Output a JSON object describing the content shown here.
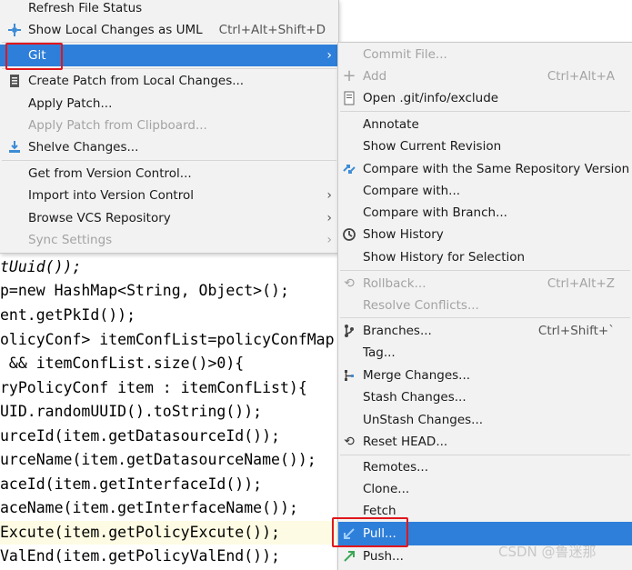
{
  "colors": {
    "menu_bg": "#f2f2f2",
    "selection": "#2e7fd9",
    "highlight_box": "#e0161c",
    "keyword": "#000080",
    "field": "#871094"
  },
  "menu_main": {
    "items": [
      {
        "label": "Refresh File Status",
        "icon": "",
        "disabled": false
      },
      {
        "label": "Show Local Changes as UML",
        "shortcut": "Ctrl+Alt+Shift+D",
        "icon": "uml-icon"
      },
      {
        "label": "Git",
        "submenu": true,
        "selected": true
      },
      {
        "label": "Create Patch from Local Changes...",
        "icon": "patch-icon"
      },
      {
        "label": "Apply Patch..."
      },
      {
        "label": "Apply Patch from Clipboard...",
        "disabled": true
      },
      {
        "label": "Shelve Changes...",
        "icon": "shelve-icon"
      },
      {
        "label": "Get from Version Control..."
      },
      {
        "label": "Import into Version Control",
        "submenu": true
      },
      {
        "label": "Browse VCS Repository",
        "submenu": true
      },
      {
        "label": "Sync Settings",
        "submenu": true,
        "disabled": true
      }
    ]
  },
  "menu_git": {
    "items": [
      {
        "label": "Commit File...",
        "disabled": true
      },
      {
        "label": "Add",
        "shortcut": "Ctrl+Alt+A",
        "disabled": true,
        "icon": "plus-icon"
      },
      {
        "label": "Open .git/info/exclude",
        "icon": "file-icon"
      },
      {
        "label": "Annotate"
      },
      {
        "label": "Show Current Revision"
      },
      {
        "label": "Compare with the Same Repository Version",
        "icon": "compare-icon"
      },
      {
        "label": "Compare with..."
      },
      {
        "label": "Compare with Branch..."
      },
      {
        "label": "Show History",
        "icon": "history-icon"
      },
      {
        "label": "Show History for Selection"
      },
      {
        "label": "Rollback...",
        "shortcut": "Ctrl+Alt+Z",
        "disabled": true,
        "icon": "rollback-icon"
      },
      {
        "label": "Resolve Conflicts...",
        "disabled": true
      },
      {
        "label": "Branches...",
        "shortcut": "Ctrl+Shift+`",
        "icon": "branch-icon"
      },
      {
        "label": "Tag..."
      },
      {
        "label": "Merge Changes...",
        "icon": "merge-icon"
      },
      {
        "label": "Stash Changes..."
      },
      {
        "label": "UnStash Changes..."
      },
      {
        "label": "Reset HEAD...",
        "icon": "reset-icon"
      },
      {
        "label": "Remotes..."
      },
      {
        "label": "Clone..."
      },
      {
        "label": "Fetch"
      },
      {
        "label": "Pull...",
        "selected": true,
        "icon": "pull-icon"
      },
      {
        "label": "Push...",
        "icon": "push-icon"
      }
    ]
  },
  "code_lines": [
    "tUuid());",
    "p=new HashMap<String, Object>();",
    "ent.getPkId());",
    "olicyConf> itemConfList=policyConfMap",
    " && itemConfList.size()>0){",
    "ryPolicyConf item : itemConfList){",
    "UID.randomUUID().toString());",
    "urceId(item.getDatasourceId());",
    "urceName(item.getDatasourceName());",
    "aceId(item.getInterfaceId());",
    "aceName(item.getInterfaceName());",
    "Excute(item.getPolicyExcute());",
    "ValEnd(item.getPolicyValEnd());"
  ],
  "watermark": "CSDN @鲁迷那"
}
